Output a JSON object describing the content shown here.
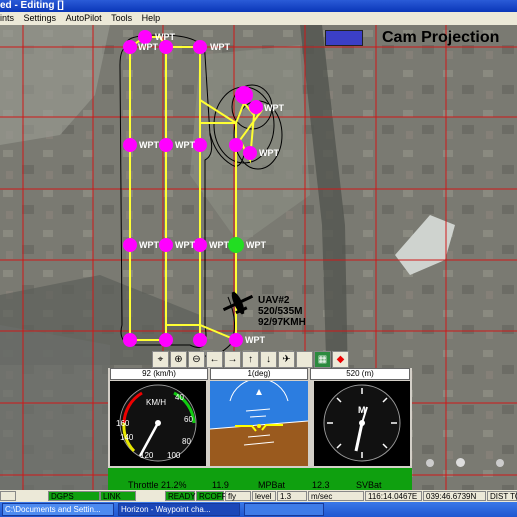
{
  "window": {
    "title": "ed - Editing []"
  },
  "menu": [
    {
      "label": "ints"
    },
    {
      "label": "Settings"
    },
    {
      "label": "AutoPilot"
    },
    {
      "label": "Tools"
    },
    {
      "label": "Help"
    }
  ],
  "map": {
    "overlay_title": "Cam Projection",
    "waypoint_label": "WPT",
    "uav": {
      "name": "UAV#2",
      "altitude": "520/535M",
      "speed": "92/97KMH"
    },
    "colors": {
      "waypoint": "#ff00ff",
      "active_waypoint": "#22dd22",
      "route": "#ffff33",
      "grid": "#d01818",
      "cam_rect": "#3b3fc6"
    }
  },
  "toolbar": {
    "buttons": [
      {
        "icon": "center-icon",
        "glyph": "⌖"
      },
      {
        "icon": "zoom-in-icon",
        "glyph": "⊕"
      },
      {
        "icon": "zoom-out-icon",
        "glyph": "⊖"
      },
      {
        "icon": "arrow-left-icon",
        "glyph": "←"
      },
      {
        "icon": "arrow-right-icon",
        "glyph": "→"
      },
      {
        "icon": "arrow-up-icon",
        "glyph": "↑"
      },
      {
        "icon": "arrow-down-icon",
        "glyph": "↓"
      },
      {
        "icon": "plane-icon",
        "glyph": "✈"
      },
      {
        "icon": "blank-icon",
        "glyph": ""
      },
      {
        "icon": "color-icon",
        "glyph": "▦"
      },
      {
        "icon": "diamond-icon",
        "glyph": "◆"
      }
    ]
  },
  "instruments": {
    "speed_setting": "92 (km/h)",
    "roll_setting": "1(deg)",
    "altitude_setting": "520 (m)",
    "airspeed_unit": "KM/H",
    "airspeed_ticks": [
      "40",
      "60",
      "140",
      "160",
      "120",
      "100",
      "80"
    ],
    "altimeter_label": "M",
    "throttle": "Throttle 21.2%",
    "mp_bat_value": "11.9",
    "mp_bat_label": "MPBat",
    "sv_bat_value": "12.3",
    "sv_bat_label": "SVBat"
  },
  "status": {
    "dgps": "DGPS",
    "link": "LINK",
    "ready": "READY",
    "rcoff": "RCOFF",
    "fly": "fly",
    "level_label": "level",
    "level_value": "1.3",
    "vspeed": "m/sec",
    "lon": "116:14.0467E",
    "lat": "039:46.6739N",
    "dist": "DIST TO GO"
  },
  "taskbar": [
    {
      "label": "C:\\Documents and Settin..."
    },
    {
      "label": "Horizon - Waypoint cha..."
    }
  ]
}
